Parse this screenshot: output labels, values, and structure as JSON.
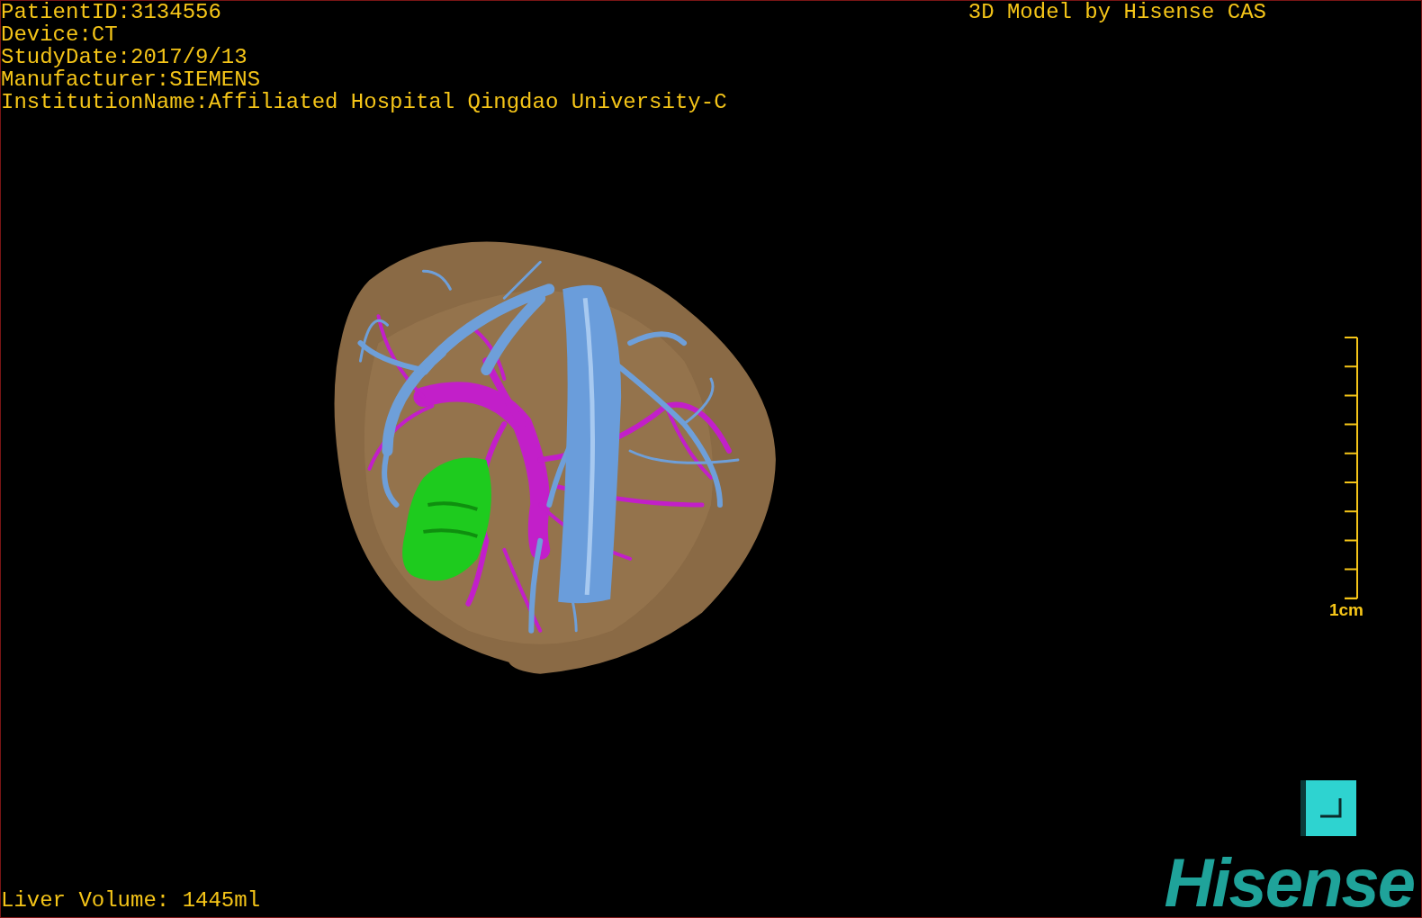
{
  "info_lines": [
    "PatientID:3134556",
    "Device:CT",
    "StudyDate:2017/9/13",
    "Manufacturer:SIEMENS",
    "InstitutionName:Affiliated Hospital Qingdao University-C"
  ],
  "title": "3D Model by Hisense CAS",
  "scale_bar": {
    "label": "1cm"
  },
  "liver_volume": "Liver Volume: 1445ml",
  "logo": {
    "text": "Hisense"
  }
}
